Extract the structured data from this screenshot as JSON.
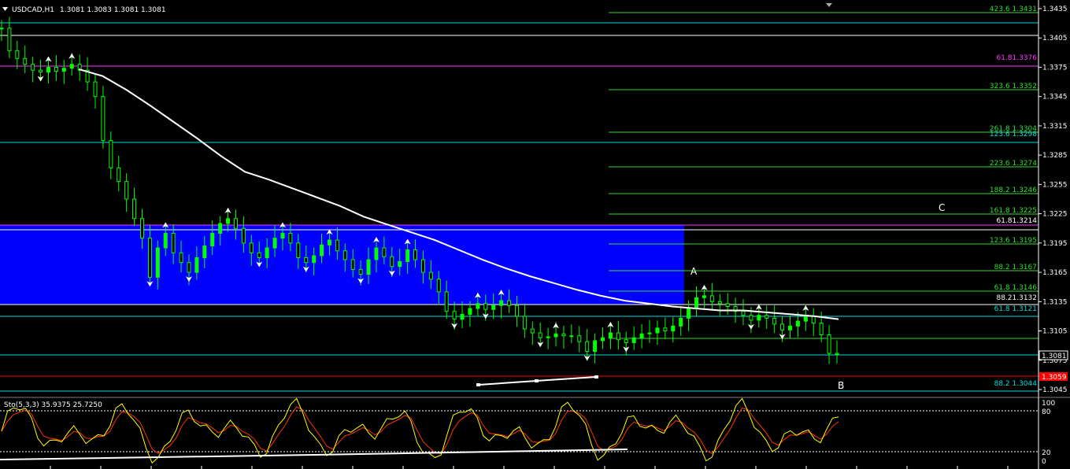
{
  "header": {
    "symbol": "USDCAD,H1",
    "ohlc": "1.3081 1.3083 1.3081 1.3081"
  },
  "price_axis": {
    "ticks": [
      "1.3435",
      "1.3405",
      "1.3375",
      "1.3345",
      "1.3315",
      "1.3285",
      "1.3255",
      "1.3225",
      "1.3195",
      "1.3165",
      "1.3135",
      "1.3105",
      "1.3075",
      "1.3045"
    ],
    "current_price": "1.3081",
    "red_marker": "1.3059"
  },
  "fib_levels": [
    {
      "label": "423.6 1.3431",
      "color": "#33dd33"
    },
    {
      "label": "61.81.3376",
      "color": "#ff33ff"
    },
    {
      "label": "323.6 1.3352",
      "color": "#33dd33"
    },
    {
      "label": "261.8 1.3304",
      "color": "#33dd33"
    },
    {
      "label": "123.6 1.3298",
      "color": "#00dddd"
    },
    {
      "label": "223.6 1.3274",
      "color": "#33dd33"
    },
    {
      "label": "188.2 1.3246",
      "color": "#33dd33"
    },
    {
      "label": "161.8 1.3225",
      "color": "#33dd33"
    },
    {
      "label": "61.81.3214",
      "color": "#ffffff"
    },
    {
      "label": "123.6 1.3195",
      "color": "#33dd33"
    },
    {
      "label": "88.2 1.3167",
      "color": "#33dd33"
    },
    {
      "label": "61.8 1.3146",
      "color": "#33dd33"
    },
    {
      "label": "88.21.3132",
      "color": "#ffffff"
    },
    {
      "label": "61.8 1.3121",
      "color": "#00dddd"
    },
    {
      "label": "88.2 1.3044",
      "color": "#00dddd"
    }
  ],
  "wave_labels": {
    "a": "A",
    "b": "B",
    "c": "C"
  },
  "oscillator": {
    "label": "Sto(5,3,3) 35.9375 25.7250",
    "ticks": [
      "100",
      "80",
      "20",
      "0"
    ]
  },
  "colors": {
    "background": "#000000",
    "bull_candle": "#00ff00",
    "zone": "#0000ff",
    "moving_average": "#ffffff",
    "stoch_main": "#ffff00",
    "stoch_signal": "#ff3300"
  },
  "chart_data": {
    "type": "line",
    "title": "USDCAD,H1",
    "ylim": [
      1.3035,
      1.3445
    ],
    "series": [
      {
        "y": [
          1.3415,
          1.3392,
          1.3384,
          1.3378,
          1.3372,
          1.337,
          1.3375,
          1.3371,
          1.3374,
          1.3378,
          1.3372,
          1.336,
          1.3345,
          1.33,
          1.3272,
          1.3258,
          1.324,
          1.322,
          1.32,
          1.316,
          1.319,
          1.3205,
          1.3185,
          1.3175,
          1.3165,
          1.318,
          1.3192,
          1.3205,
          1.3215,
          1.322,
          1.321,
          1.3195,
          1.3185,
          1.318,
          1.319,
          1.32,
          1.3205,
          1.3195,
          1.318,
          1.3175,
          1.3182,
          1.3193,
          1.3198,
          1.3187,
          1.3178,
          1.3168,
          1.3163,
          1.3178,
          1.319,
          1.3181,
          1.3171,
          1.3176,
          1.3188,
          1.3178,
          1.3165,
          1.3158,
          1.3145,
          1.3125,
          1.3117,
          1.3122,
          1.3128,
          1.3133,
          1.3127,
          1.3131,
          1.3136,
          1.3131,
          1.312,
          1.3107,
          1.3103,
          1.3098,
          1.3099,
          1.3102,
          1.31,
          1.31,
          1.3094,
          1.3084,
          1.3095,
          1.3098,
          1.3103,
          1.3096,
          1.3093,
          1.3098,
          1.3102,
          1.3103,
          1.3108,
          1.3105,
          1.311,
          1.3118,
          1.3128,
          1.3139,
          1.3141,
          1.3135,
          1.3133,
          1.313,
          1.3125,
          1.3121,
          1.3116,
          1.3121,
          1.3118,
          1.3112,
          1.3106,
          1.311,
          1.3115,
          1.312,
          1.3113,
          1.3101,
          1.3082,
          1.3081
        ]
      },
      {
        "y": [
          1.3373,
          1.3366,
          1.3352,
          1.3336,
          1.3319,
          1.3302,
          1.3284,
          1.3268,
          1.326,
          1.3251,
          1.3242,
          1.3233,
          1.3222,
          1.3214,
          1.3206,
          1.3198,
          1.3188,
          1.3178,
          1.3169,
          1.3161,
          1.3154,
          1.3147,
          1.3141,
          1.3136,
          1.3133,
          1.313,
          1.3128,
          1.3126,
          1.3126,
          1.3124,
          1.3122,
          1.312,
          1.3117
        ]
      }
    ]
  }
}
